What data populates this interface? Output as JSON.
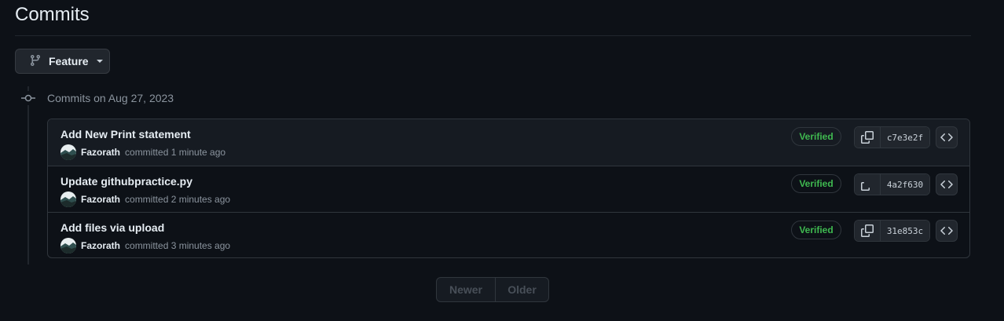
{
  "page": {
    "title": "Commits"
  },
  "branch": {
    "name": "Feature"
  },
  "group": {
    "heading": "Commits on Aug 27, 2023"
  },
  "commits": [
    {
      "message": "Add New Print statement",
      "author": "Fazorath",
      "committed": "committed 1 minute ago",
      "badge": "Verified",
      "sha": "c7e3e2f"
    },
    {
      "message": "Update githubpractice.py",
      "author": "Fazorath",
      "committed": "committed 2 minutes ago",
      "badge": "Verified",
      "sha": "4a2f630"
    },
    {
      "message": "Add files via upload",
      "author": "Fazorath",
      "committed": "committed 3 minutes ago",
      "badge": "Verified",
      "sha": "31e853c"
    }
  ],
  "pagination": {
    "newer": "Newer",
    "older": "Older"
  },
  "colors": {
    "verified": "#3fb950",
    "background": "#0d1117",
    "border": "#30363d"
  }
}
